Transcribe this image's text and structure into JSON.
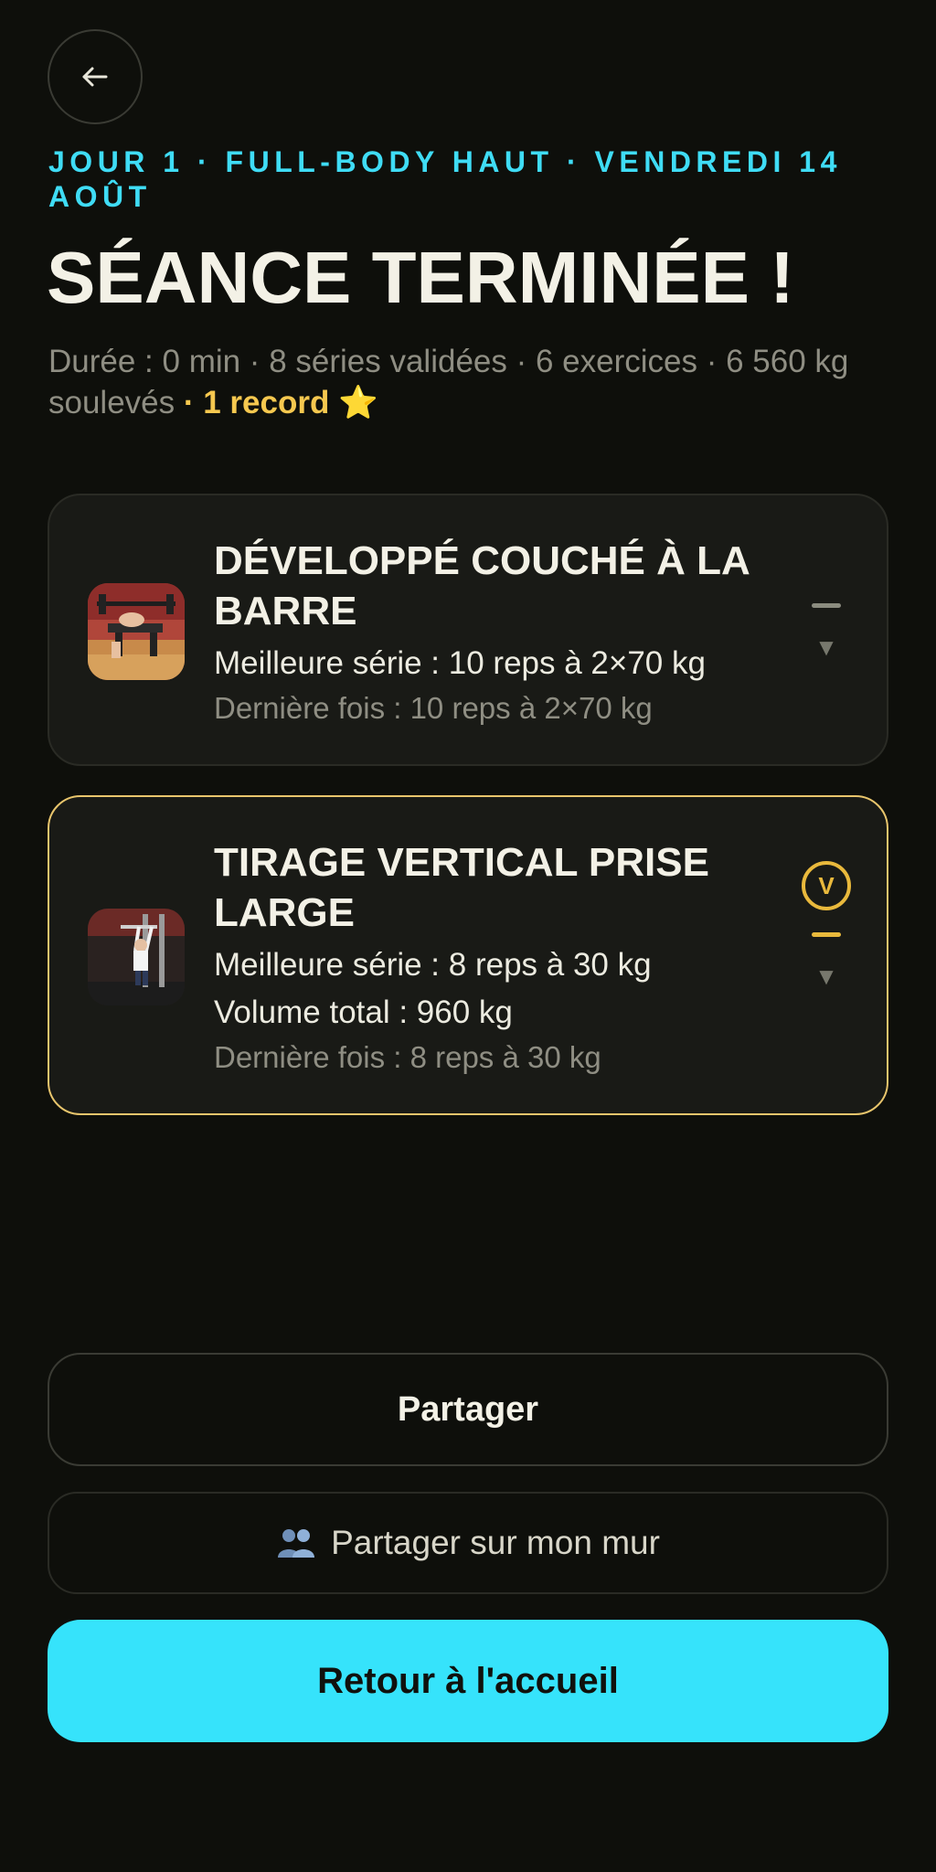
{
  "header": {
    "back_icon": "arrow-left-icon",
    "subtitle": "JOUR 1 · FULL-BODY HAUT · VENDREDI 14 AOÛT",
    "title": "SÉANCE TERMINÉE !",
    "summary_text": "Durée : 0 min · 8 séries validées · 6 exercices · 6 560 kg soulevés",
    "summary_record": " · 1 record ⭐"
  },
  "exercises": [
    {
      "name": "DÉVELOPPÉ COUCHÉ À LA BARRE",
      "best_set": "Meilleure série : 10 reps à 2×70 kg",
      "last_time": "Dernière fois : 10 reps à 2×70 kg",
      "thumbnail": "bench-press-photo",
      "record": false
    },
    {
      "name": "TIRAGE VERTICAL PRISE LARGE",
      "best_set": "Meilleure série : 8 reps à 30 kg",
      "total_volume": "Volume total : 960 kg",
      "last_time": "Dernière fois : 8 reps à 30 kg",
      "thumbnail": "lat-pulldown-photo",
      "record": true,
      "record_badge": "V"
    }
  ],
  "actions": {
    "share_label": "Partager",
    "share_wall_label": "Partager sur mon mur",
    "share_wall_icon": "people-icon",
    "home_label": "Retour à l'accueil"
  },
  "colors": {
    "background": "#0e0f0b",
    "accent_cyan": "#36e3fb",
    "record_gold": "#e9b93c",
    "card_bg": "#191a16"
  }
}
